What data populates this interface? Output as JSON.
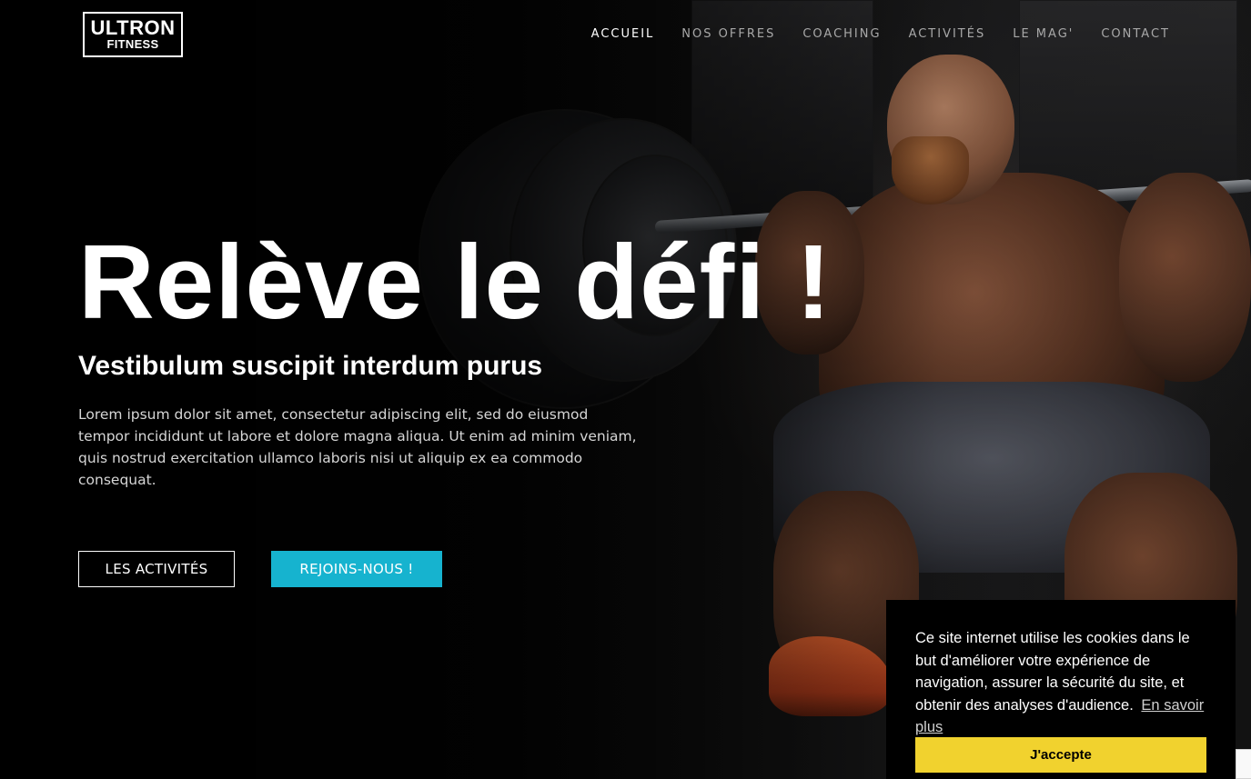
{
  "header": {
    "logo": {
      "line1": "ULTRON",
      "line2": "FITNESS"
    },
    "nav": [
      {
        "label": "ACCUEIL",
        "active": true
      },
      {
        "label": "NOS OFFRES",
        "active": false
      },
      {
        "label": "COACHING",
        "active": false
      },
      {
        "label": "ACTIVITÉS",
        "active": false
      },
      {
        "label": "LE MAG'",
        "active": false
      },
      {
        "label": "CONTACT",
        "active": false
      }
    ]
  },
  "hero": {
    "title": "Relève le défi !",
    "subtitle": "Vestibulum suscipit interdum purus",
    "text": "Lorem ipsum dolor sit amet, consectetur adipiscing elit, sed do eiusmod tempor incididunt ut labore et dolore magna aliqua. Ut enim ad minim veniam, quis nostrud exercitation ullamco laboris nisi ut aliquip ex ea commodo consequat.",
    "buttons": {
      "secondary": "LES ACTIVITÉS",
      "primary": "REJOINS-NOUS !"
    }
  },
  "cookie_banner": {
    "message": "Ce site internet utilise les cookies dans le but d'améliorer votre expérience de navigation, assurer la sécurité du site, et obtenir des analyses d'audience.",
    "link": "En savoir plus",
    "accept": "J'accepte"
  },
  "colors": {
    "accent": "#16b3cf",
    "cookie_button": "#f1d22e",
    "background": "#000000"
  }
}
